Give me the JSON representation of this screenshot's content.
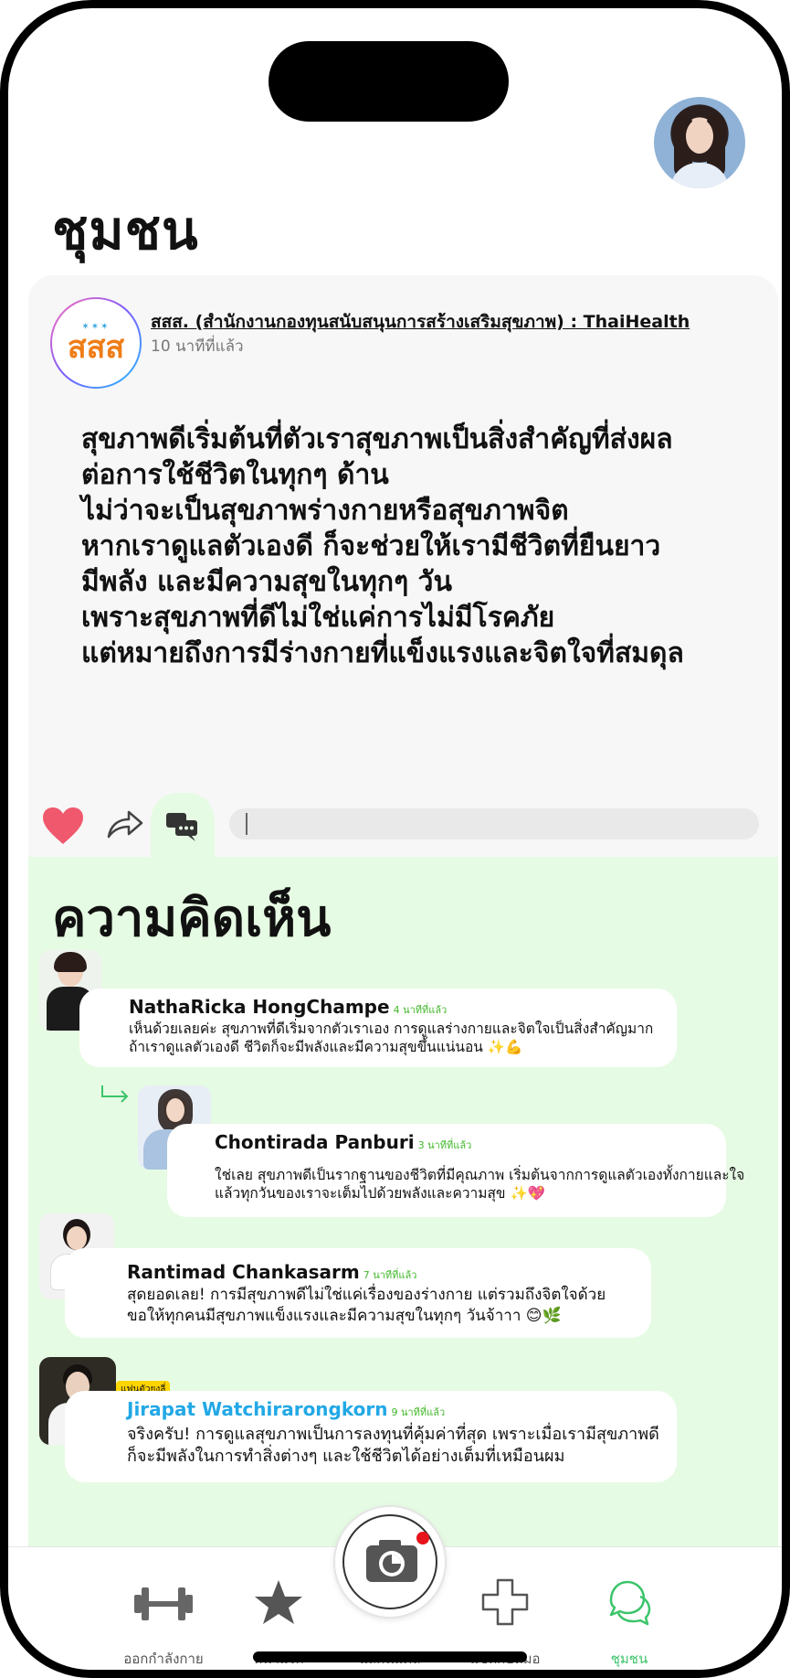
{
  "header": {
    "title": "ชุมชน"
  },
  "post": {
    "org_logo_text": "สสส",
    "author": "สสส. (สำนักงานกองทุนสนับสนุนการสร้างเสริมสุขภาพ) : ThaiHealth",
    "time": "10 นาทีที่แล้ว",
    "lines": [
      "สุขภาพดีเริ่มต้นที่ตัวเราสุขภาพเป็นสิ่งสำคัญที่ส่งผล",
      "ต่อการใช้ชีวิตในทุกๆ ด้าน",
      "ไม่ว่าจะเป็นสุขภาพร่างกายหรือสุขภาพจิต",
      "หากเราดูแลตัวเองดี ก็จะช่วยให้เรามีชีวิตที่ยืนยาว",
      "มีพลัง และมีความสุขในทุกๆ วัน",
      "เพราะสุขภาพที่ดีไม่ใช่แค่การไม่มีโรคภัย",
      "แต่หมายถึงการมีร่างกายที่แข็งแรงและจิตใจที่สมดุล"
    ],
    "comment_placeholder": ""
  },
  "comments_section": {
    "title": "ความคิดเห็น",
    "items": [
      {
        "name": "NathaRicka HongChampe",
        "time": "4 นาทีที่แล้ว",
        "lines": [
          "เห็นด้วยเลยค่ะ สุขภาพที่ดีเริ่มจากตัวเราเอง การดูแลร่างกายและจิตใจเป็นสิ่งสำคัญมาก",
          "ถ้าเราดูแลตัวเองดี ชีวิตก็จะมีพลังและมีความสุขขึ้นแน่นอน ✨💪"
        ]
      },
      {
        "name": "Chontirada Panburi",
        "time": "3 นาทีที่แล้ว",
        "lines": [
          "ใช่เลย สุขภาพดีเป็นรากฐานของชีวิตที่มีคุณภาพ เริ่มต้นจากการดูแลตัวเองทั้งกายและใจ",
          "แล้วทุกวันของเราจะเต็มไปด้วยพลังและความสุข ✨💖"
        ]
      },
      {
        "name": "Rantimad Chankasarm",
        "time": "7 นาทีที่แล้ว",
        "lines": [
          "สุดยอดเลย! การมีสุขภาพดีไม่ใช่แค่เรื่องของร่างกาย แต่รวมถึงจิตใจด้วย",
          "ขอให้ทุกคนมีสุขภาพแข็งแรงและมีความสุขในทุกๆ วันจ้าาา 😊🌿"
        ]
      },
      {
        "badge": "แฟนตัวยงลี่",
        "name": "Jirapat Watchirarongkorn",
        "time": "9 นาทีที่แล้ว",
        "lines": [
          "จริงครับ! การดูแลสุขภาพเป็นการลงทุนที่คุ้มค่าที่สุด เพราะเมื่อเรามีสุขภาพดี",
          "ก็จะมีพลังในการทำสิ่งต่างๆ และใช้ชีวิตได้อย่างเต็มที่เหมือนผม"
        ]
      }
    ]
  },
  "nav": {
    "items": [
      {
        "label": "ออกกำลังกาย",
        "icon": "dumbbell-icon"
      },
      {
        "label": "หน้าแรก",
        "icon": "star-icon"
      },
      {
        "label": "แสกนแคล",
        "icon": "camera-icon"
      },
      {
        "label": "แชทกับหมอ",
        "icon": "plus-icon"
      },
      {
        "label": "ชุมชน",
        "icon": "chat-bubbles-icon"
      }
    ],
    "active_color": "#3cc46b"
  },
  "colors": {
    "comments_bg": "#e6fbe3",
    "heart": "#f0586e",
    "accent_green": "#3cc46b"
  }
}
